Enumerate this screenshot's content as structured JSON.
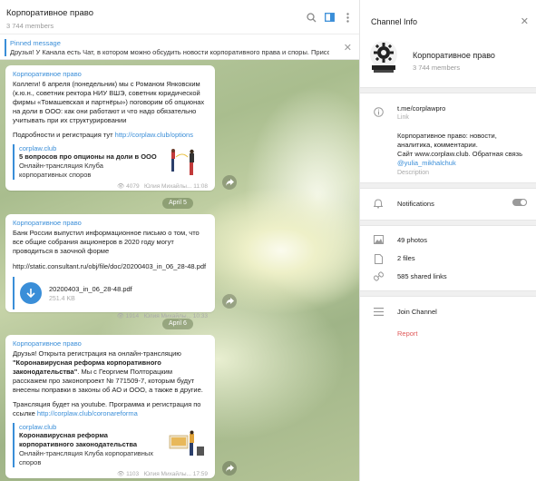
{
  "header": {
    "title": "Корпоративное право",
    "subtitle": "3 744 members"
  },
  "pinned": {
    "title": "Pinned message",
    "text": "Друзья! У Канала есть Чат, в котором можно обсудить новости корпоративного права и споры. Присое..."
  },
  "messages": [
    {
      "author": "Корпоративное право",
      "text": "Коллеги! 6 апреля (понедельник) мы с Романом Янковским (к.ю.н., советник ректора НИУ ВШЭ, советник юридической фирмы «Томашевская и партнёры») поговорим об опционах на доли в ООО: как они работают и что надо обязательно учитывать при их структурировании",
      "text2": "Подробности и регистрация тут ",
      "link": "http://corplaw.club/options",
      "preview": {
        "site": "corplaw.club",
        "title": "5 вопросов про опционы на доли в ООО",
        "desc": "Онлайн-трансляция Клуба корпоративных споров"
      },
      "views": "4079",
      "signature": "Юлия Михайлы...",
      "time": "11:08"
    },
    {
      "date": "April 5",
      "author": "Корпоративное право",
      "text": "Банк России выпустил информационное письмо о том, что все общие собрания акционеров в 2020 году могут проводиться в заочной форме",
      "link": "http://static.consultant.ru/obj/file/doc/20200403_in_06_28-48.pdf",
      "file": {
        "name": "20200403_in_06_28-48.pdf",
        "size": "251.4 KB"
      },
      "views": "1914",
      "signature": "Юлия Михайлы...",
      "time": "10:33"
    },
    {
      "date": "April 6",
      "author": "Корпоративное право",
      "text_a": "Друзья! Открыта регистрация на онлайн-трансляцию ",
      "text_bold": "\"Коронавирусная реформа корпоративного законодательства\"",
      "text_b": ". Мы с Георгием Полторацким расскажем про законопроект № 771509-7, которым будут внесены поправки в законы об АО и ООО, а также в другие.",
      "text2": "Трансляция будет на youtube. Программа и регистрация по ссылке ",
      "link": "http://corplaw.club/coronareforma",
      "preview": {
        "site": "corplaw.club",
        "title": "Коронавирусная реформа корпоративного законодательства",
        "desc": "Онлайн-трансляция Клуба корпоративных споров"
      },
      "views": "1103",
      "signature": "Юлия Михайлы...",
      "time": "17:59"
    }
  ],
  "info": {
    "title": "Channel Info",
    "channel_name": "Корпоративное право",
    "members": "3 744 members",
    "link": "t.me/corplawpro",
    "link_label": "Link",
    "description_l1": "Корпоративное право: новости,",
    "description_l2": "аналитика, комментарии.",
    "description_l3": "Сайт www.corplaw.club. Обратная связь",
    "description_handle": "@yulia_mikhalchuk",
    "description_label": "Description",
    "notifications": "Notifications",
    "photos": "49 photos",
    "files": "2 files",
    "links": "585 shared links",
    "join": "Join Channel",
    "report": "Report"
  },
  "colors": {
    "accent": "#3a8ed8",
    "report": "#e05a5a"
  }
}
